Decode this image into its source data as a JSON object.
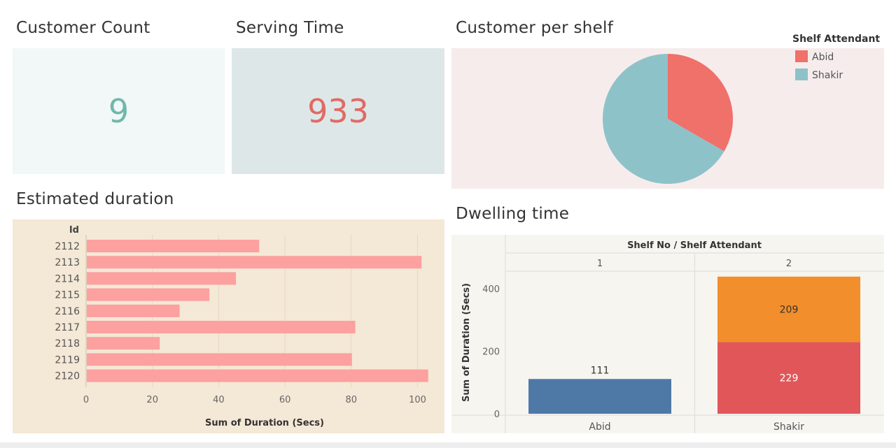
{
  "kpis": {
    "customer_count": {
      "title": "Customer Count",
      "value": "9",
      "color": "#6fb8ab",
      "bg": "#f2f7f7"
    },
    "serving_time": {
      "title": "Serving Time",
      "value": "933",
      "color": "#e06a65",
      "bg": "#dee7e8"
    }
  },
  "pie_panel": {
    "title": "Customer per shelf",
    "bg": "#f6ecec"
  },
  "bar_panel": {
    "title": "Estimated duration",
    "bg": "#f4e8d6"
  },
  "stack_panel": {
    "title": "Dwelling time",
    "bg": "#f6f5f0"
  },
  "chart_data": [
    {
      "type": "pie",
      "legend_title": "Shelf Attendant",
      "legend_position": "top-right",
      "slices": [
        {
          "label": "Abid",
          "value": 3,
          "color": "#f0706a"
        },
        {
          "label": "Shakir",
          "value": 6,
          "color": "#8ec2c9"
        }
      ]
    },
    {
      "type": "bar",
      "orientation": "horizontal",
      "categories_header": "Id",
      "categories": [
        "2112",
        "2113",
        "2114",
        "2115",
        "2116",
        "2117",
        "2118",
        "2119",
        "2120"
      ],
      "values": [
        52,
        101,
        45,
        37,
        28,
        81,
        22,
        80,
        103
      ],
      "xlabel": "Sum of Duration (Secs)",
      "xlim": [
        0,
        110
      ],
      "xticks": [
        0,
        20,
        40,
        60,
        80,
        100
      ],
      "bar_color": "#fca0a0",
      "grid": true
    },
    {
      "type": "bar",
      "stacked": true,
      "header": "Shelf No / Shelf Attendant",
      "groups": [
        "1",
        "2"
      ],
      "categories": [
        "Abid",
        "Shakir"
      ],
      "ylabel": "Sum of Duration (Secs)",
      "ylim": [
        0,
        460
      ],
      "yticks": [
        0,
        200,
        400
      ],
      "series": [
        {
          "values": [
            111,
            229
          ],
          "colors": [
            "#4e79a7",
            "#e15759"
          ]
        },
        {
          "values": [
            0,
            209
          ],
          "colors": [
            "#4e79a7",
            "#f28e2b"
          ]
        }
      ]
    }
  ]
}
